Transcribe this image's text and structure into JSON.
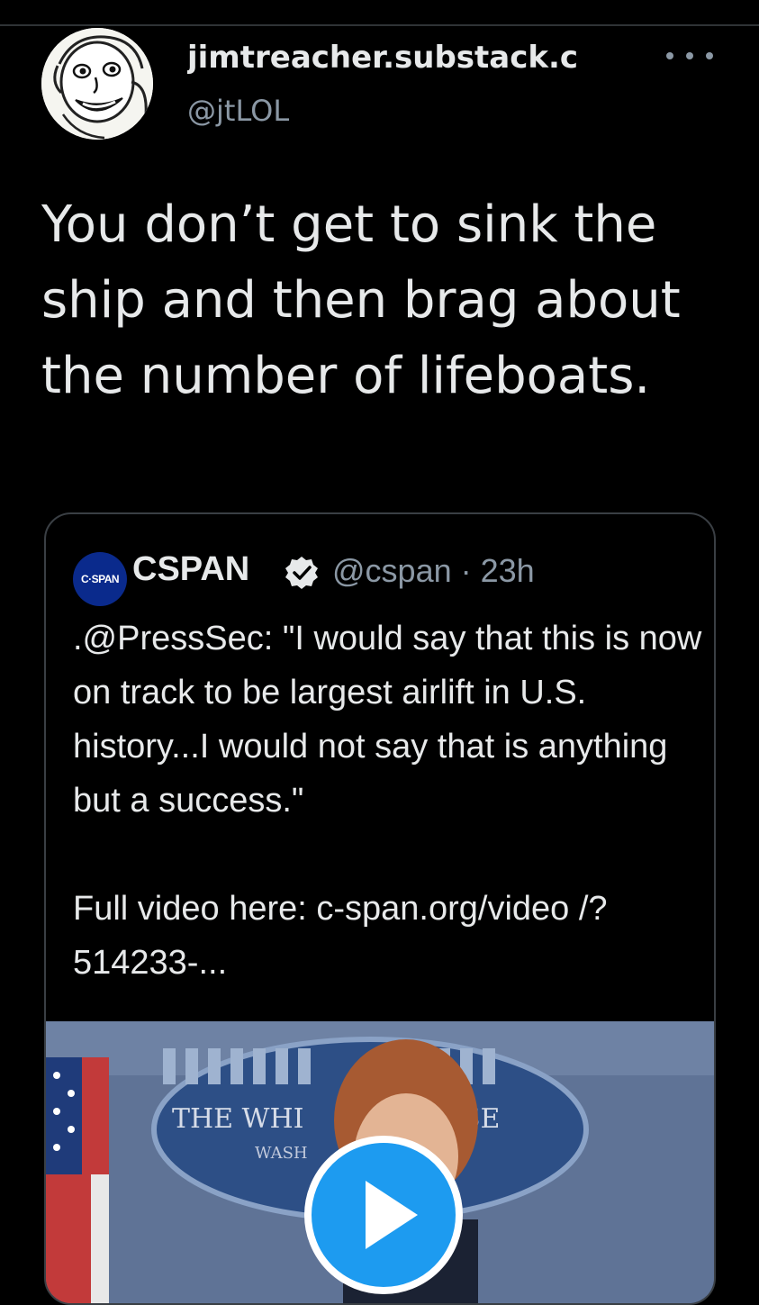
{
  "tweet": {
    "display_name": "jimtreacher.substack.c",
    "handle": "@jtLOL",
    "text": "You don’t get to sink the ship and then brag about the number of lifeboats.",
    "more_icon": "more-horizontal-icon"
  },
  "quoted_tweet": {
    "avatar_text": "C·SPAN",
    "name": "CSPAN",
    "verified_icon": "verified-badge-icon",
    "handle_time": "@cspan · 23h",
    "text_line1": ".@PressSec: \"I would say that this is now on track to be largest airlift in U.S. history...I would not say that is anything but a success.\"",
    "text_line2": "Full video here: c-span.org/video /?514233-...",
    "media": {
      "sign_text_1": "THE WHI",
      "sign_text_2": "SE",
      "sign_text_3": "WASH",
      "play_icon": "play-icon"
    }
  },
  "colors": {
    "background": "#000000",
    "text_primary": "#e7e9ea",
    "text_secondary": "#8b98a5",
    "border": "#3a3f44",
    "play_blue": "#1d9bf0"
  }
}
